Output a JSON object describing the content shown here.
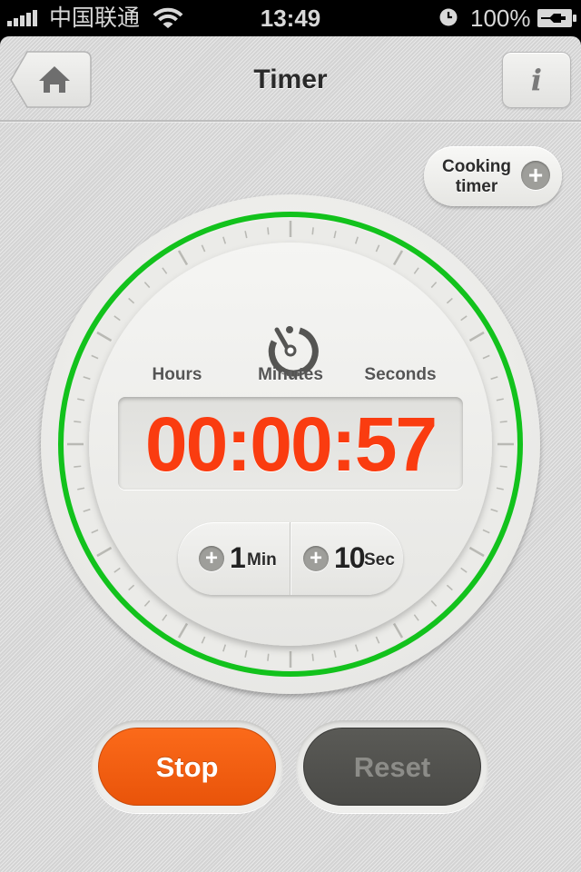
{
  "status_bar": {
    "carrier": "中国联通",
    "time": "13:49",
    "battery_percent": "100%",
    "signal_bars": 5,
    "icons": [
      "signal-icon",
      "wifi-icon",
      "clock-icon",
      "battery-charging-icon"
    ]
  },
  "nav": {
    "title": "Timer",
    "home_icon": "home-icon",
    "info_label": "i"
  },
  "cooking_timer": {
    "label": "Cooking timer",
    "icon": "plus-icon"
  },
  "timer": {
    "units": [
      "Hours",
      "Minutes",
      "Seconds"
    ],
    "display": "00:00:57",
    "hours": "00",
    "minutes": "00",
    "seconds": "57",
    "icon": "stopwatch-icon",
    "progress_fraction": 1.0,
    "ring_color": "#12c21c",
    "digit_color": "#fa3c10"
  },
  "increments": [
    {
      "value": "1",
      "unit": "Min",
      "icon": "plus-icon"
    },
    {
      "value": "10",
      "unit": "Sec",
      "icon": "plus-icon"
    }
  ],
  "buttons": {
    "stop": {
      "label": "Stop",
      "color": "#f55f12"
    },
    "reset": {
      "label": "Reset",
      "color": "#52524f",
      "enabled": false
    }
  }
}
